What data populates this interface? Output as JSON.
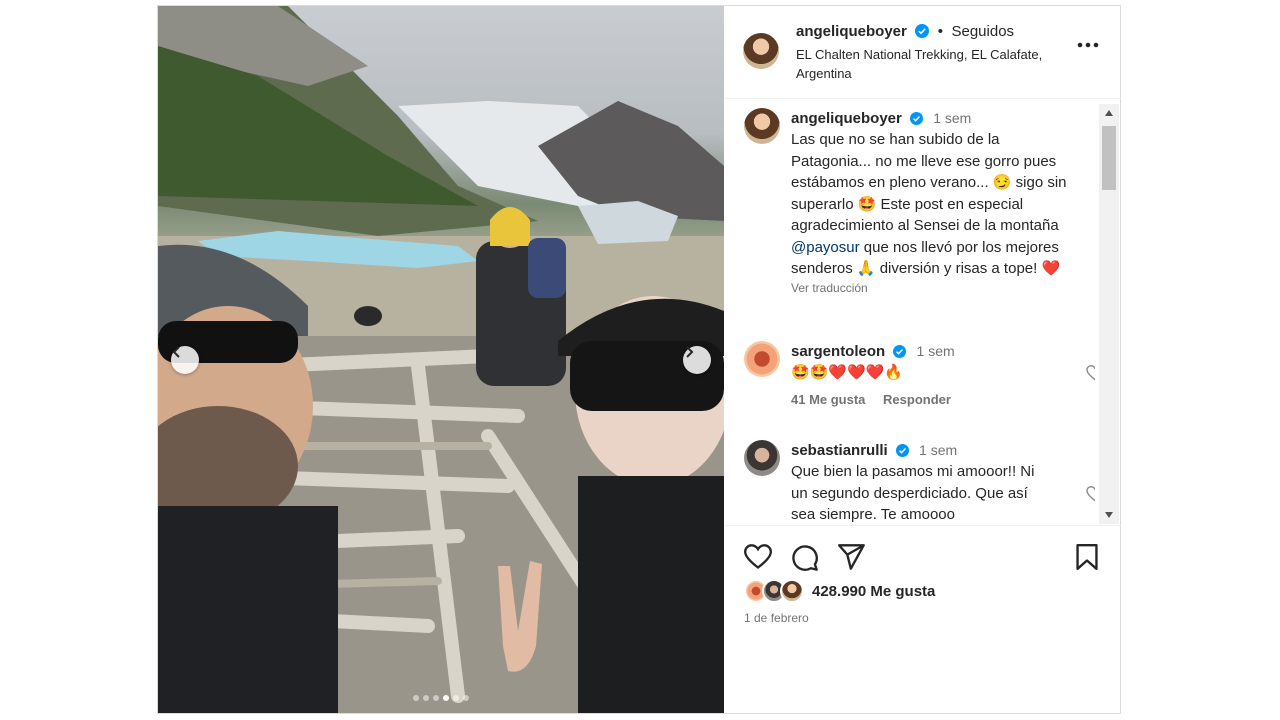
{
  "post": {
    "author": "angeliqueboyer",
    "follow_status": "Seguidos",
    "separator": "•",
    "location": "EL Chalten National Trekking, EL Calafate, Argentina"
  },
  "caption": {
    "author": "angeliqueboyer",
    "time": "1 sem",
    "text_before_mention": "Las que no se han subido de la Patagonia... no me lleve ese gorro pues estábamos en pleno verano... 😏 sigo sin superarlo 🤩 Este post en especial agradecimiento al Sensei de la montaña ",
    "mention": "@payosur",
    "text_after_mention": " que nos llevó por los mejores senderos 🙏 diversión y risas a tope! ❤️",
    "translate": "Ver traducción"
  },
  "comments": [
    {
      "username": "sargentoleon",
      "time": "1 sem",
      "text": "🤩🤩❤️❤️❤️🔥",
      "likes": "41 Me gusta",
      "reply": "Responder"
    },
    {
      "username": "sebastianrulli",
      "time": "1 sem",
      "text": "Que bien la pasamos mi amooor!! Ni un segundo desperdiciado. Que así sea siempre. Te amoooo"
    }
  ],
  "footer": {
    "likes": "428.990 Me gusta",
    "date": "1 de febrero"
  },
  "carousel": {
    "slides": 6,
    "active_index": 3
  },
  "colors": {
    "verified": "#0095f6",
    "heart": "#ed4956",
    "mention": "#00376b"
  },
  "icons": [
    "verified-icon",
    "more-options-icon",
    "heart-icon",
    "comment-icon",
    "share-icon",
    "bookmark-icon",
    "chevron-left-icon",
    "chevron-right-icon",
    "scroll-up-icon",
    "scroll-down-icon"
  ]
}
